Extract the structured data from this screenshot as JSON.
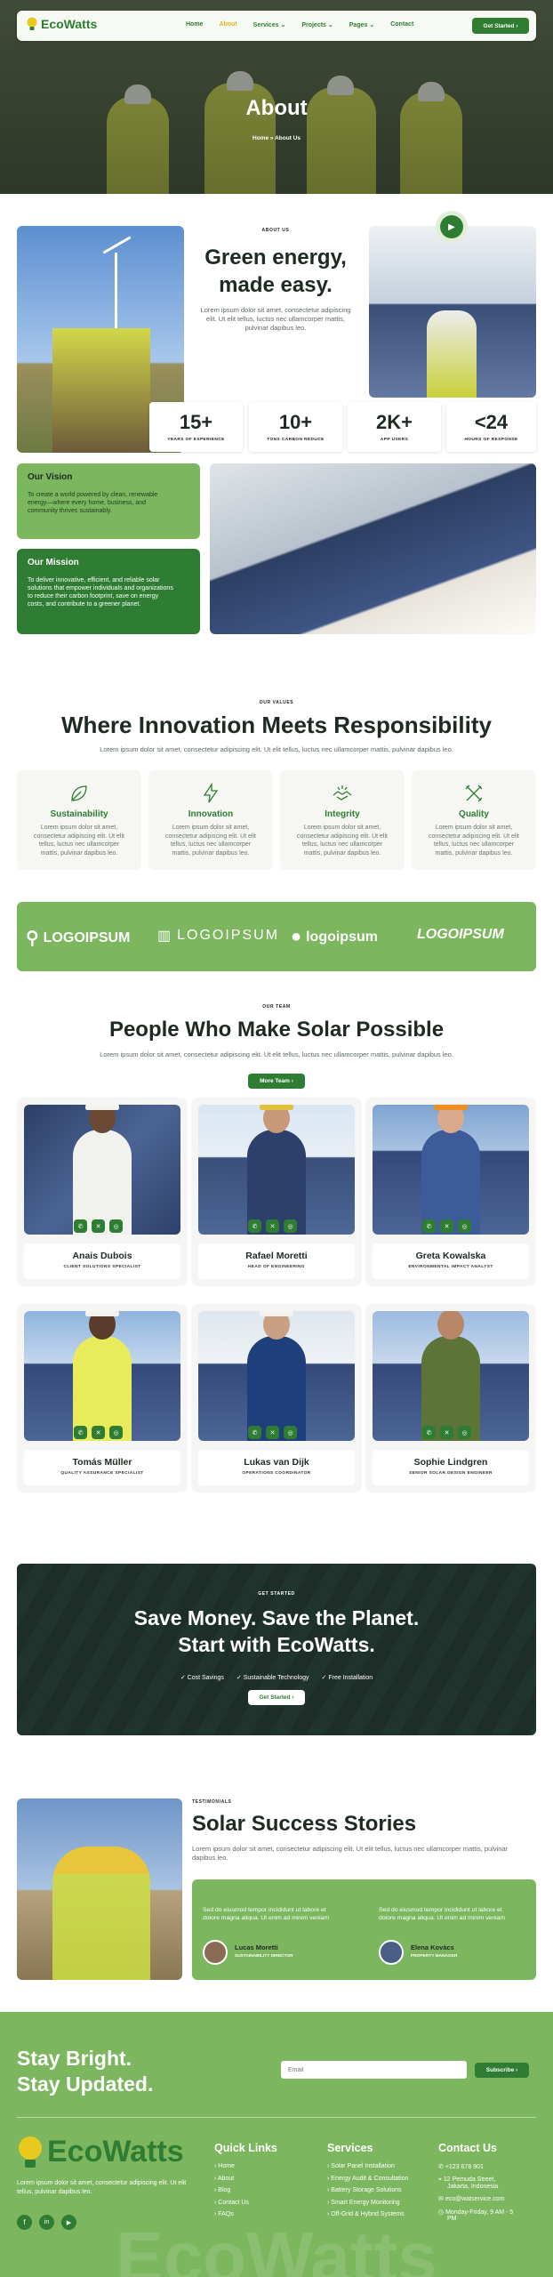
{
  "brand": {
    "name": "EcoWatts",
    "logo_icon": "lightbulb-icon"
  },
  "nav": {
    "items": [
      "Home",
      "About",
      "Services",
      "Projects",
      "Pages",
      "Contact"
    ],
    "dropdown_items": [
      "Services",
      "Projects",
      "Pages"
    ],
    "active": "About",
    "cta": "Get Started"
  },
  "hero": {
    "title": "About",
    "breadcrumb_home": "Home",
    "breadcrumb_sep": "»",
    "breadcrumb_current": "About Us"
  },
  "intro": {
    "label": "ABOUT US",
    "title_line1": "Green energy,",
    "title_line2": "made easy.",
    "text_line1": "Lorem ipsum dolor sit amet, consectetur adipiscing",
    "text_line2": "elit. Ut elit tellus, luctus nec ullamcorper mattis,",
    "text_line3": "pulvinar dapibus leo."
  },
  "stats": [
    {
      "value": "15+",
      "label": "YEARS OF EXPERIENCE"
    },
    {
      "value": "10+",
      "label": "TONS CARBON REDUCE"
    },
    {
      "value": "2K+",
      "label": "APP USERS"
    },
    {
      "value": "<24",
      "label": "HOURS OF RESPONSE"
    }
  ],
  "vision": {
    "title": "Our Vision",
    "text_lines": [
      "To create a world powered by clean, renewable",
      "energy—where every home, business, and",
      "community thrives sustainably."
    ]
  },
  "mission": {
    "title": "Our Mission",
    "text_lines": [
      "To deliver innovative, efficient, and reliable solar",
      "solutions that empower individuals and organizations",
      "to reduce their carbon footprint, save on energy",
      "costs, and contribute to a greener planet."
    ]
  },
  "values": {
    "label": "OUR VALUES",
    "title": "Where Innovation Meets Responsibility",
    "subtitle": "Lorem ipsum dolor sit amet, consectetur adipiscing elit. Ut elit tellus, luctus nec ullamcorper mattis, pulvinar dapibus leo.",
    "items": [
      {
        "title": "Sustainability",
        "icon": "leaf-icon"
      },
      {
        "title": "Innovation",
        "icon": "bolt-icon"
      },
      {
        "title": "Integrity",
        "icon": "handshake-icon"
      },
      {
        "title": "Quality",
        "icon": "tools-icon"
      }
    ],
    "item_text_lines": [
      "Lorem ipsum dolor sit amet,",
      "consectetur adipiscing elit. Ut elit",
      "tellus, luctus nec ullamcorper",
      "mattis, pulvinar dapibus leo."
    ]
  },
  "partners": [
    "LOGOIPSUM",
    "LOGOIPSUM",
    "logoipsum",
    "LOGOIPSUM"
  ],
  "team": {
    "label": "OUR TEAM",
    "title": "People Who Make Solar Possible",
    "subtitle": "Lorem ipsum dolor sit amet, consectetur adipiscing elit. Ut elit tellus, luctus nec ullamcorper mattis, pulvinar dapibus leo.",
    "button": "More Team",
    "members": [
      {
        "name": "Anais Dubois",
        "role": "CLIENT SOLUTIONS SPECIALIST"
      },
      {
        "name": "Rafael Moretti",
        "role": "HEAD OF ENGINEERING"
      },
      {
        "name": "Greta Kowalska",
        "role": "ENVIRONMENTAL IMPACT ANALYST"
      },
      {
        "name": "Tomás Müller",
        "role": "QUALITY ASSURANCE SPECIALIST"
      },
      {
        "name": "Lukas van Dijk",
        "role": "OPERATIONS COORDINATOR"
      },
      {
        "name": "Sophie Lindgren",
        "role": "SENIOR SOLAR DESIGN ENGINEER"
      }
    ],
    "social_icons": [
      "whatsapp-icon",
      "x-icon",
      "instagram-icon"
    ]
  },
  "cta": {
    "label": "GET STARTED",
    "title_line1": "Save Money. Save the Planet.",
    "title_line2": "Start with EcoWatts.",
    "features": [
      "Cost Savings",
      "Sustainable Technology",
      "Free Installation"
    ],
    "button": "Get Started"
  },
  "testimonials": {
    "label": "TESTIMONIALS",
    "title": "Solar Success Stories",
    "subtitle": "Lorem ipsum dolor sit amet, consectetur adipiscing elit. Ut elit tellus, luctus nec ullamcorper mattis, pulvinar dapibus leo.",
    "items": [
      {
        "quote_lines": [
          "Sed do eiusmod tempor incididunt ut labore et",
          "dolore magna aliqua. Ut enim ad minim veniam"
        ],
        "name": "Lucas Moretti",
        "role": "SUSTAINABILITY DIRECTOR"
      },
      {
        "quote_lines": [
          "Sed do eiusmod tempor incididunt ut labore et",
          "dolore magna aliqua. Ut enim ad minim veniam"
        ],
        "name": "Elena Kovács",
        "role": "PROPERTY MANAGER"
      }
    ]
  },
  "newsletter": {
    "title_line1": "Stay Bright.",
    "title_line2": "Stay Updated.",
    "placeholder": "Email",
    "button": "Subscribe"
  },
  "footer": {
    "about_lines": [
      "Lorem ipsum dolor sit amet, consectetur adipiscing elit. Ut elit",
      "tellus, pulvinar dapibus leo."
    ],
    "quick_links_title": "Quick Links",
    "quick_links": [
      "Home",
      "About",
      "Blog",
      "Contact Us",
      "FAQs"
    ],
    "services_title": "Services",
    "services": [
      "Solar Panel Installation",
      "Energy Audit & Consultation",
      "Battery Storage Solutions",
      "Smart Energy Monitoring",
      "Off-Grid & Hybrid Systems"
    ],
    "contact_title": "Contact Us",
    "phone": "+123 678 901",
    "address_line1": "12 Pemuda Street,",
    "address_line2": "Jakarta, Indonesia",
    "email": "eco@watservice.com",
    "hours_line1": "Monday-Friday, 9 AM - 5",
    "hours_line2": "PM",
    "social_icons": [
      "facebook-icon",
      "linkedin-icon",
      "youtube-icon"
    ],
    "watermark": "EcoWatts"
  },
  "colors": {
    "primary": "#2e7d32",
    "light_green": "#7cb65e",
    "accent_yellow": "#d6b71a"
  }
}
